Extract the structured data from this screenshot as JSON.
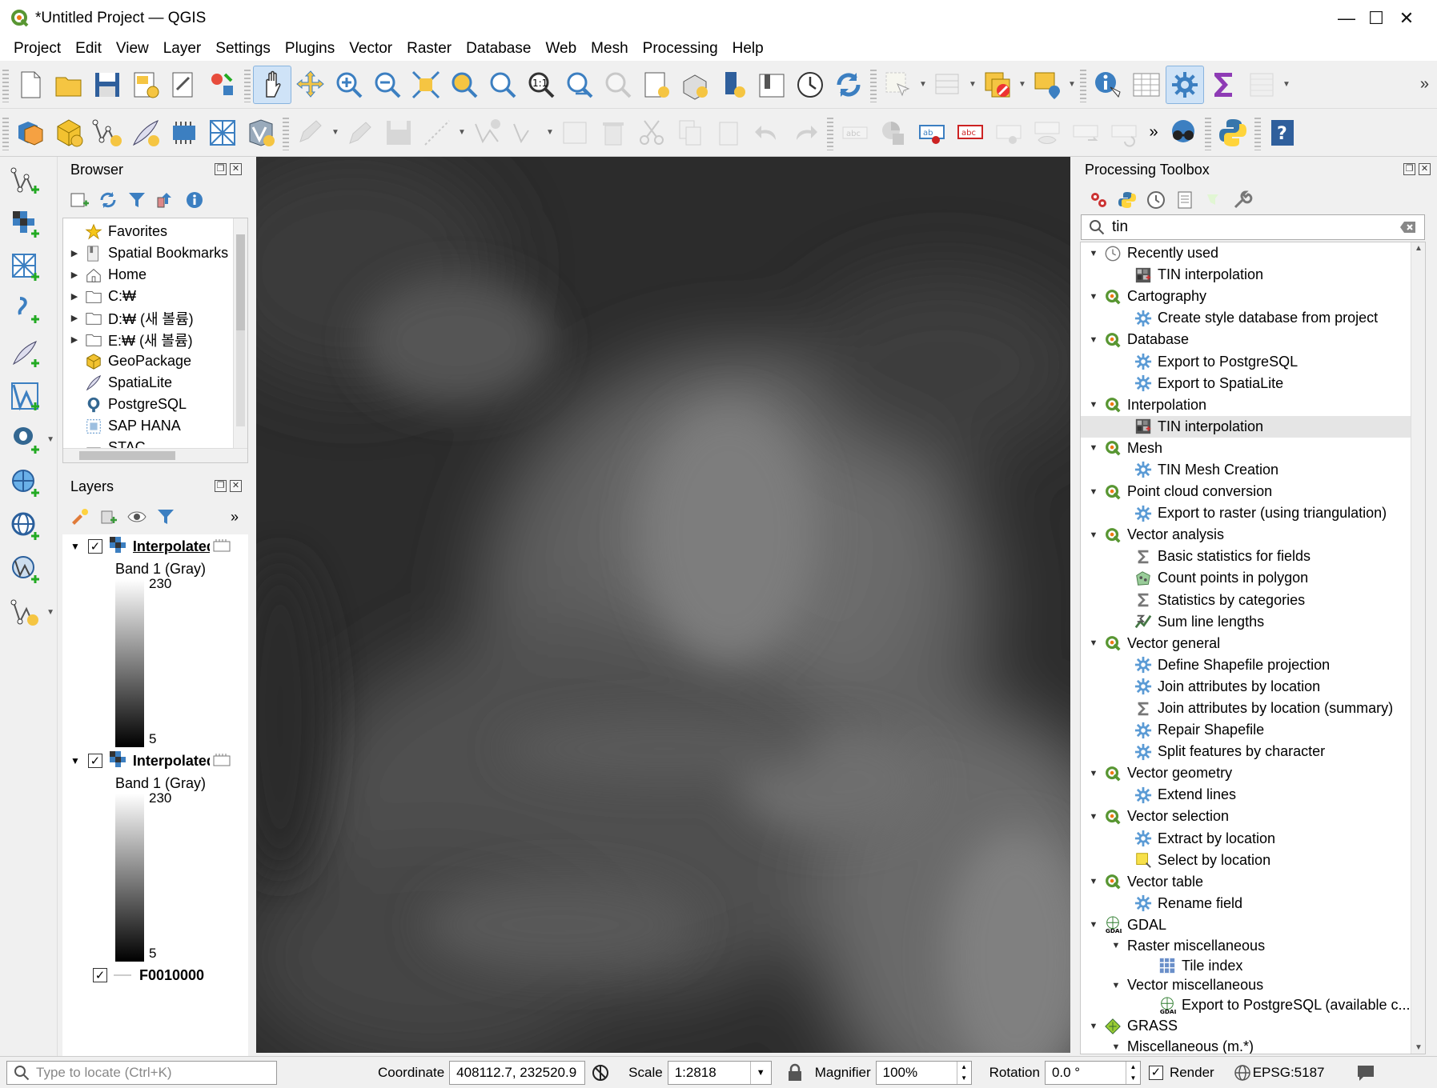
{
  "window": {
    "title": "*Untitled Project — QGIS",
    "minimize": "—",
    "maximize": "☐",
    "close": "✕"
  },
  "menu": [
    "Project",
    "Edit",
    "View",
    "Layer",
    "Settings",
    "Plugins",
    "Vector",
    "Raster",
    "Database",
    "Web",
    "Mesh",
    "Processing",
    "Help"
  ],
  "toolbar_overflow": "»",
  "browser": {
    "title": "Browser",
    "items": [
      {
        "label": "Favorites",
        "icon": "star-icon",
        "expand": ""
      },
      {
        "label": "Spatial Bookmarks",
        "icon": "bookmark-icon",
        "expand": "▶"
      },
      {
        "label": "Home",
        "icon": "home-icon",
        "expand": "▶"
      },
      {
        "label": "C:₩",
        "icon": "folder-icon",
        "expand": "▶"
      },
      {
        "label": "D:₩ (새 볼륨)",
        "icon": "folder-icon",
        "expand": "▶"
      },
      {
        "label": "E:₩ (새 볼륨)",
        "icon": "folder-icon",
        "expand": "▶"
      },
      {
        "label": "GeoPackage",
        "icon": "geopackage-icon",
        "expand": ""
      },
      {
        "label": "SpatiaLite",
        "icon": "spatialite-icon",
        "expand": ""
      },
      {
        "label": "PostgreSQL",
        "icon": "postgresql-icon",
        "expand": ""
      },
      {
        "label": "SAP HANA",
        "icon": "sap-hana-icon",
        "expand": ""
      },
      {
        "label": "STAC",
        "icon": "stac-icon",
        "expand": ""
      }
    ]
  },
  "layers": {
    "title": "Layers",
    "items": [
      {
        "name": "Interpolated",
        "band": "Band 1 (Gray)",
        "max": "230",
        "min": "5"
      },
      {
        "name": "Interpolated",
        "band": "Band 1 (Gray)",
        "max": "230",
        "min": "5"
      }
    ],
    "vector": "F0010000"
  },
  "processing": {
    "title": "Processing Toolbox",
    "search_value": "tin",
    "tree": [
      {
        "type": "grp",
        "label": "Recently used",
        "icon": "clock-icon"
      },
      {
        "type": "itm",
        "label": "TIN interpolation",
        "icon": "raster-algorithm-icon"
      },
      {
        "type": "grp",
        "label": "Cartography",
        "icon": "qgis-icon"
      },
      {
        "type": "itm",
        "label": "Create style database from project",
        "icon": "gear-icon"
      },
      {
        "type": "grp",
        "label": "Database",
        "icon": "qgis-icon"
      },
      {
        "type": "itm",
        "label": "Export to PostgreSQL",
        "icon": "gear-icon"
      },
      {
        "type": "itm",
        "label": "Export to SpatiaLite",
        "icon": "gear-icon"
      },
      {
        "type": "grp",
        "label": "Interpolation",
        "icon": "qgis-icon"
      },
      {
        "type": "itm",
        "label": "TIN interpolation",
        "icon": "raster-algorithm-icon",
        "selected": true
      },
      {
        "type": "grp",
        "label": "Mesh",
        "icon": "qgis-icon"
      },
      {
        "type": "itm",
        "label": "TIN Mesh Creation",
        "icon": "gear-icon"
      },
      {
        "type": "grp",
        "label": "Point cloud conversion",
        "icon": "qgis-icon"
      },
      {
        "type": "itm",
        "label": "Export to raster (using triangulation)",
        "icon": "gear-icon"
      },
      {
        "type": "grp",
        "label": "Vector analysis",
        "icon": "qgis-icon"
      },
      {
        "type": "itm",
        "label": "Basic statistics for fields",
        "icon": "sigma-icon"
      },
      {
        "type": "itm",
        "label": "Count points in polygon",
        "icon": "count-points-icon"
      },
      {
        "type": "itm",
        "label": "Statistics by categories",
        "icon": "sigma-icon"
      },
      {
        "type": "itm",
        "label": "Sum line lengths",
        "icon": "sum-lines-icon"
      },
      {
        "type": "grp",
        "label": "Vector general",
        "icon": "qgis-icon"
      },
      {
        "type": "itm",
        "label": "Define Shapefile projection",
        "icon": "gear-icon"
      },
      {
        "type": "itm",
        "label": "Join attributes by location",
        "icon": "gear-icon"
      },
      {
        "type": "itm",
        "label": "Join attributes by location (summary)",
        "icon": "sigma-icon"
      },
      {
        "type": "itm",
        "label": "Repair Shapefile",
        "icon": "gear-icon"
      },
      {
        "type": "itm",
        "label": "Split features by character",
        "icon": "gear-icon"
      },
      {
        "type": "grp",
        "label": "Vector geometry",
        "icon": "qgis-icon"
      },
      {
        "type": "itm",
        "label": "Extend lines",
        "icon": "gear-icon"
      },
      {
        "type": "grp",
        "label": "Vector selection",
        "icon": "qgis-icon"
      },
      {
        "type": "itm",
        "label": "Extract by location",
        "icon": "gear-icon"
      },
      {
        "type": "itm",
        "label": "Select by location",
        "icon": "select-location-icon"
      },
      {
        "type": "grp",
        "label": "Vector table",
        "icon": "qgis-icon"
      },
      {
        "type": "itm",
        "label": "Rename field",
        "icon": "gear-icon"
      },
      {
        "type": "grp",
        "label": "GDAL",
        "icon": "gdal-icon"
      },
      {
        "type": "sub",
        "label": "Raster miscellaneous",
        "icon": ""
      },
      {
        "type": "itm2",
        "label": "Tile index",
        "icon": "tile-index-icon"
      },
      {
        "type": "sub",
        "label": "Vector miscellaneous",
        "icon": ""
      },
      {
        "type": "itm2",
        "label": "Export to PostgreSQL (available c...",
        "icon": "gdal-icon"
      },
      {
        "type": "grp",
        "label": "GRASS",
        "icon": "grass-icon"
      },
      {
        "type": "sub",
        "label": "Miscellaneous (m.*)",
        "icon": ""
      }
    ]
  },
  "status": {
    "locate_placeholder": "Type to locate (Ctrl+K)",
    "coordinate_label": "Coordinate",
    "coordinate_value": "408112.7, 232520.9",
    "scale_label": "Scale",
    "scale_value": "1:2818",
    "magnifier_label": "Magnifier",
    "magnifier_value": "100%",
    "rotation_label": "Rotation",
    "rotation_value": "0.0 °",
    "render_label": "Render",
    "crs": "EPSG:5187"
  },
  "colors": {
    "qgis_green": "#589632",
    "accent": "#3c7fc1"
  }
}
